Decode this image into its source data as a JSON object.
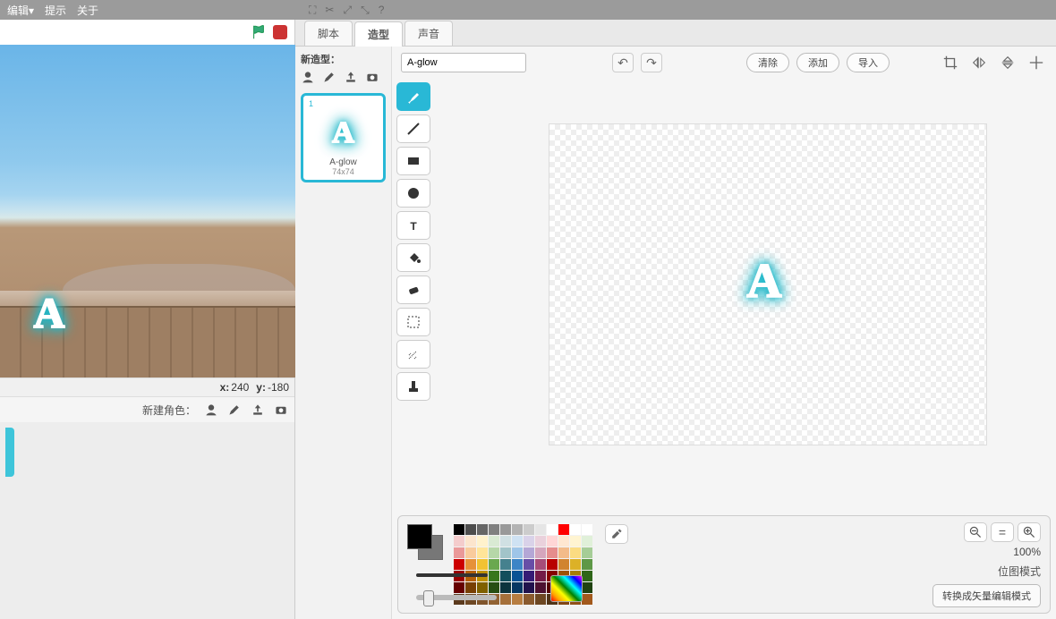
{
  "menu": {
    "edit": "编辑▾",
    "hints": "提示",
    "about": "关于"
  },
  "stage": {
    "x_label": "x:",
    "x_val": "240",
    "y_label": "y:",
    "y_val": "-180"
  },
  "sprite_bar": {
    "label": "新建角色："
  },
  "tabs": {
    "scripts": "脚本",
    "costumes": "造型",
    "sounds": "声音"
  },
  "costumes": {
    "new_label": "新造型：",
    "items": [
      {
        "num": "1",
        "name": "A-glow",
        "dims": "74x74"
      }
    ]
  },
  "paint": {
    "name_input": "A-glow",
    "btn_clear": "清除",
    "btn_add": "添加",
    "btn_import": "导入"
  },
  "zoom": {
    "out": "−",
    "reset": "=",
    "in": "+",
    "percent": "100%"
  },
  "mode": {
    "label": "位图模式",
    "convert": "转换成矢量编辑模式"
  },
  "palette_colors": [
    "#000000",
    "#4d4d4d",
    "#666666",
    "#808080",
    "#999999",
    "#b3b3b3",
    "#cccccc",
    "#e5e5e5",
    "#ffffff",
    "#ff0000",
    "#ffffff",
    "#ffffff",
    "#f4cccc",
    "#fce5cd",
    "#fff2cc",
    "#d9ead3",
    "#d0e0e3",
    "#cfe2f3",
    "#d9d2e9",
    "#ead1dc",
    "#ffd6d6",
    "#ffe7d1",
    "#fff4d1",
    "#e0f0d9",
    "#ea9999",
    "#f9cb9c",
    "#ffe599",
    "#b6d7a8",
    "#a2c4c9",
    "#9fc5e8",
    "#b4a7d6",
    "#d5a6bd",
    "#e58d8d",
    "#f3bb89",
    "#fbdc82",
    "#a6cd97",
    "#cc0000",
    "#e69138",
    "#f1c232",
    "#6aa84f",
    "#45818e",
    "#3d85c6",
    "#674ea7",
    "#a64d79",
    "#b80000",
    "#d1842e",
    "#dcb127",
    "#5e9846",
    "#990000",
    "#b45f06",
    "#bf9000",
    "#38761d",
    "#134f5c",
    "#0b5394",
    "#351c75",
    "#741b47",
    "#850000",
    "#9e5204",
    "#a87d00",
    "#2f6618",
    "#660000",
    "#783f04",
    "#7f6000",
    "#274e13",
    "#0c343d",
    "#073763",
    "#20124d",
    "#4c1130",
    "#550000",
    "#663504",
    "#6b5000",
    "#204211",
    "#5b3a1e",
    "#6e4825",
    "#80552c",
    "#926233",
    "#a5703a",
    "#b77d41",
    "#8a5a2e",
    "#6d4722",
    "#503417",
    "#804515",
    "#914f18",
    "#a2591c"
  ]
}
